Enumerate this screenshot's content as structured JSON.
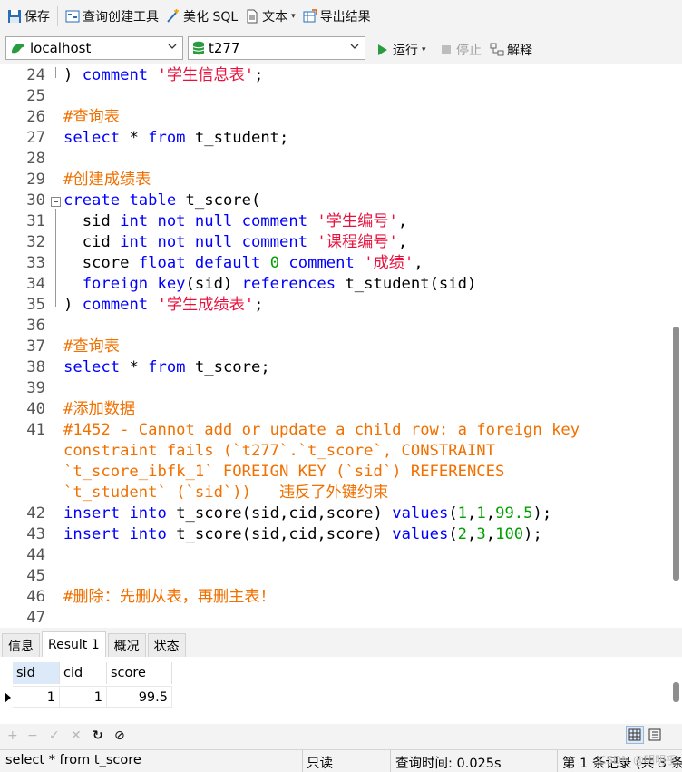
{
  "toolbar": {
    "save": "保存",
    "query_builder": "查询创建工具",
    "beautify_sql": "美化 SQL",
    "text": "文本",
    "export": "导出结果"
  },
  "connection": {
    "server": "localhost",
    "database": "t277",
    "run": "运行",
    "stop": "停止",
    "explain": "解释"
  },
  "editor": {
    "lines": [
      {
        "n": "24",
        "tokens": [
          [
            "pl",
            ") "
          ],
          [
            "kw",
            "comment"
          ],
          [
            "pl",
            " "
          ],
          [
            "str",
            "'学生信息表'"
          ],
          [
            "pl",
            ";"
          ]
        ]
      },
      {
        "n": "25",
        "tokens": []
      },
      {
        "n": "26",
        "tokens": [
          [
            "cm",
            "#查询表"
          ]
        ]
      },
      {
        "n": "27",
        "tokens": [
          [
            "kw",
            "select"
          ],
          [
            "pl",
            " * "
          ],
          [
            "kw",
            "from"
          ],
          [
            "pl",
            " t_student;"
          ]
        ]
      },
      {
        "n": "28",
        "tokens": []
      },
      {
        "n": "29",
        "tokens": [
          [
            "cm",
            "#创建成绩表"
          ]
        ]
      },
      {
        "n": "30",
        "tokens": [
          [
            "kw",
            "create"
          ],
          [
            "pl",
            " "
          ],
          [
            "kw",
            "table"
          ],
          [
            "pl",
            " t_score("
          ]
        ]
      },
      {
        "n": "31",
        "tokens": [
          [
            "pl",
            "  sid "
          ],
          [
            "kw",
            "int not null comment"
          ],
          [
            "pl",
            " "
          ],
          [
            "str",
            "'学生编号'"
          ],
          [
            "pl",
            ","
          ]
        ]
      },
      {
        "n": "32",
        "tokens": [
          [
            "pl",
            "  cid "
          ],
          [
            "kw",
            "int not null comment"
          ],
          [
            "pl",
            " "
          ],
          [
            "str",
            "'课程编号'"
          ],
          [
            "pl",
            ","
          ]
        ]
      },
      {
        "n": "33",
        "tokens": [
          [
            "pl",
            "  score "
          ],
          [
            "kw",
            "float default"
          ],
          [
            "pl",
            " "
          ],
          [
            "num",
            "0"
          ],
          [
            "pl",
            " "
          ],
          [
            "kw",
            "comment"
          ],
          [
            "pl",
            " "
          ],
          [
            "str",
            "'成绩'"
          ],
          [
            "pl",
            ","
          ]
        ]
      },
      {
        "n": "34",
        "tokens": [
          [
            "pl",
            "  "
          ],
          [
            "kw",
            "foreign key"
          ],
          [
            "pl",
            "(sid) "
          ],
          [
            "kw",
            "references"
          ],
          [
            "pl",
            " t_student(sid)"
          ]
        ]
      },
      {
        "n": "35",
        "tokens": [
          [
            "pl",
            ") "
          ],
          [
            "kw",
            "comment"
          ],
          [
            "pl",
            " "
          ],
          [
            "str",
            "'学生成绩表'"
          ],
          [
            "pl",
            ";"
          ]
        ]
      },
      {
        "n": "36",
        "tokens": []
      },
      {
        "n": "37",
        "tokens": [
          [
            "cm",
            "#查询表"
          ]
        ]
      },
      {
        "n": "38",
        "tokens": [
          [
            "kw",
            "select"
          ],
          [
            "pl",
            " * "
          ],
          [
            "kw",
            "from"
          ],
          [
            "pl",
            " t_score;"
          ]
        ]
      },
      {
        "n": "39",
        "tokens": []
      },
      {
        "n": "40",
        "tokens": [
          [
            "cm",
            "#添加数据"
          ]
        ]
      },
      {
        "n": "41",
        "tokens": [
          [
            "cm",
            "#1452 - Cannot add or update a child row: a foreign key"
          ]
        ]
      },
      {
        "n": "",
        "tokens": [
          [
            "cm",
            "constraint fails (`t277`.`t_score`, CONSTRAINT"
          ]
        ]
      },
      {
        "n": "",
        "tokens": [
          [
            "cm",
            "`t_score_ibfk_1` FOREIGN KEY (`sid`) REFERENCES"
          ]
        ]
      },
      {
        "n": "",
        "tokens": [
          [
            "cm",
            "`t_student` (`sid`))   违反了外键约束"
          ]
        ]
      },
      {
        "n": "42",
        "tokens": [
          [
            "kw",
            "insert"
          ],
          [
            "pl",
            " "
          ],
          [
            "kw",
            "into"
          ],
          [
            "pl",
            " t_score(sid,cid,score) "
          ],
          [
            "kw",
            "values"
          ],
          [
            "pl",
            "("
          ],
          [
            "num",
            "1"
          ],
          [
            "pl",
            ","
          ],
          [
            "num",
            "1"
          ],
          [
            "pl",
            ","
          ],
          [
            "num",
            "99.5"
          ],
          [
            "pl",
            ");"
          ]
        ]
      },
      {
        "n": "43",
        "tokens": [
          [
            "kw",
            "insert"
          ],
          [
            "pl",
            " "
          ],
          [
            "kw",
            "into"
          ],
          [
            "pl",
            " t_score(sid,cid,score) "
          ],
          [
            "kw",
            "values"
          ],
          [
            "pl",
            "("
          ],
          [
            "num",
            "2"
          ],
          [
            "pl",
            ","
          ],
          [
            "num",
            "3"
          ],
          [
            "pl",
            ","
          ],
          [
            "num",
            "100"
          ],
          [
            "pl",
            ");"
          ]
        ]
      },
      {
        "n": "44",
        "tokens": []
      },
      {
        "n": "45",
        "tokens": []
      },
      {
        "n": "46",
        "tokens": [
          [
            "cm",
            "#删除：先删从表，再删主表！"
          ]
        ]
      },
      {
        "n": "47",
        "tokens": []
      }
    ]
  },
  "result_tabs": [
    "信息",
    "Result 1",
    "概况",
    "状态"
  ],
  "result_grid": {
    "columns": [
      "sid",
      "cid",
      "score"
    ],
    "rows": [
      [
        "1",
        "1",
        "99.5"
      ]
    ]
  },
  "status_bar": {
    "query": "select * from t_score",
    "mode": "只读",
    "time": "查询时间: 0.025s",
    "record": "第 1 条记录 (共 3 条",
    "watermark": "CSDN @明明乎"
  },
  "colors": {
    "keyword": "#0000ff",
    "string": "#e8113d",
    "comment": "#f07000",
    "number": "#00a000"
  }
}
